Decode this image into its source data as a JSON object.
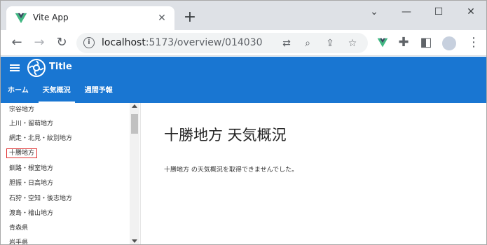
{
  "browser": {
    "tab_title": "Vite App",
    "url_host": "localhost",
    "url_path": ":5173/overview/014030"
  },
  "app": {
    "title": "Title",
    "brand_color": "#1976d2",
    "tabs": [
      "ホーム",
      "天気概況",
      "週間予報"
    ],
    "active_tab": "天気概況"
  },
  "sidebar": {
    "items": [
      "宗谷地方",
      "上川・留萌地方",
      "網走・北見・紋別地方",
      "十勝地方",
      "釧路・根室地方",
      "胆振・日高地方",
      "石狩・空知・後志地方",
      "渡島・檜山地方",
      "青森県",
      "岩手県"
    ],
    "selected": "十勝地方"
  },
  "main": {
    "title": "十勝地方 天気概況",
    "message": "十勝地方 の天気概況を取得できませんでした。"
  }
}
